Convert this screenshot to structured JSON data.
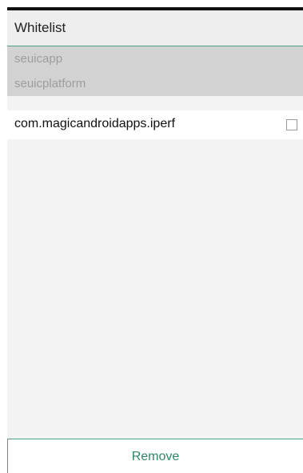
{
  "header": {
    "title": "Whitelist"
  },
  "system_items": [
    {
      "label": "seuicapp"
    },
    {
      "label": "seuicplatform"
    }
  ],
  "app_items": [
    {
      "label": "com.magicandroidapps.iperf",
      "checked": false
    }
  ],
  "footer": {
    "remove_label": "Remove"
  },
  "colors": {
    "accent": "#4aa37c",
    "remove_text": "#2e8b62",
    "system_row_bg": "#d2d2d2",
    "system_row_text": "#9d9d9d",
    "panel_bg": "#f3f3f3"
  }
}
